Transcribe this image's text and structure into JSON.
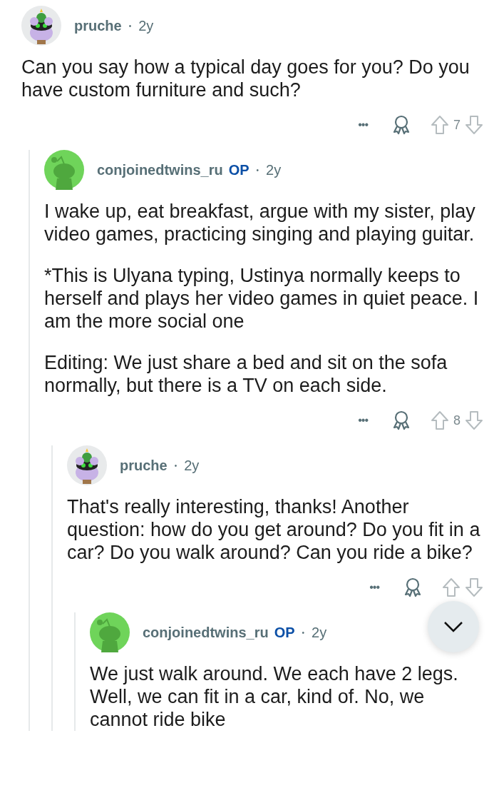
{
  "comments": [
    {
      "author": "pruche",
      "avatar": {
        "kind": "creature"
      },
      "separator": "•",
      "age": "2y",
      "paragraphs": [
        "Can you say how a typical day goes for you? Do you have custom furniture and such?"
      ],
      "more": "•••",
      "votes": "7",
      "children": [
        {
          "author": "conjoinedtwins_ru",
          "avatar": {
            "kind": "alien"
          },
          "badge": "OP",
          "separator": "•",
          "age": "2y",
          "paragraphs": [
            "I wake up, eat breakfast, argue with my sister, play video games, practicing singing and playing guitar.",
            "*This is Ulyana typing, Ustinya normally keeps to herself and plays her video games in quiet peace. I am the more social one",
            "Editing: We just share a bed and sit on the sofa normally, but there is a TV on each side."
          ],
          "more": "•••",
          "votes": "8",
          "children": [
            {
              "author": "pruche",
              "avatar": {
                "kind": "creature"
              },
              "separator": "•",
              "age": "2y",
              "paragraphs": [
                "That's really interesting, thanks! Another question: how do you get around? Do you fit in a car? Do you walk around? Can you ride a bike?"
              ],
              "more": "•••",
              "children": [
                {
                  "author": "conjoinedtwins_ru",
                  "avatar": {
                    "kind": "alien"
                  },
                  "badge": "OP",
                  "separator": "•",
                  "age": "2y",
                  "paragraphs": [
                    "We just walk around. We each have 2 legs. Well, we can fit in a car, kind of. No, we cannot ride bike"
                  ]
                }
              ]
            }
          ]
        }
      ]
    }
  ]
}
